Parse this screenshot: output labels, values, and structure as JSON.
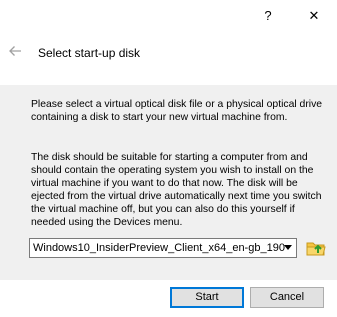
{
  "titlebar": {
    "help_label": "?",
    "close_label": "✕"
  },
  "wizard": {
    "title": "Select start-up disk",
    "paragraph1": "Please select a virtual optical disk file or a physical optical drive containing a disk to start your new virtual machine from.",
    "paragraph2": "The disk should be suitable for starting a computer from and should contain the operating system you wish to install on the virtual machine if you want to do that now. The disk will be ejected from the virtual drive automatically next time you switch the virtual machine off, but you can also do this yourself if needed using the Devices menu."
  },
  "disk_selector": {
    "selected_value": "Windows10_InsiderPreview_Client_x64_en-gb_190"
  },
  "buttons": {
    "start_label": "Start",
    "cancel_label": "Cancel"
  },
  "colors": {
    "accent": "#0078d7",
    "content_bg": "#f0f0f0"
  }
}
